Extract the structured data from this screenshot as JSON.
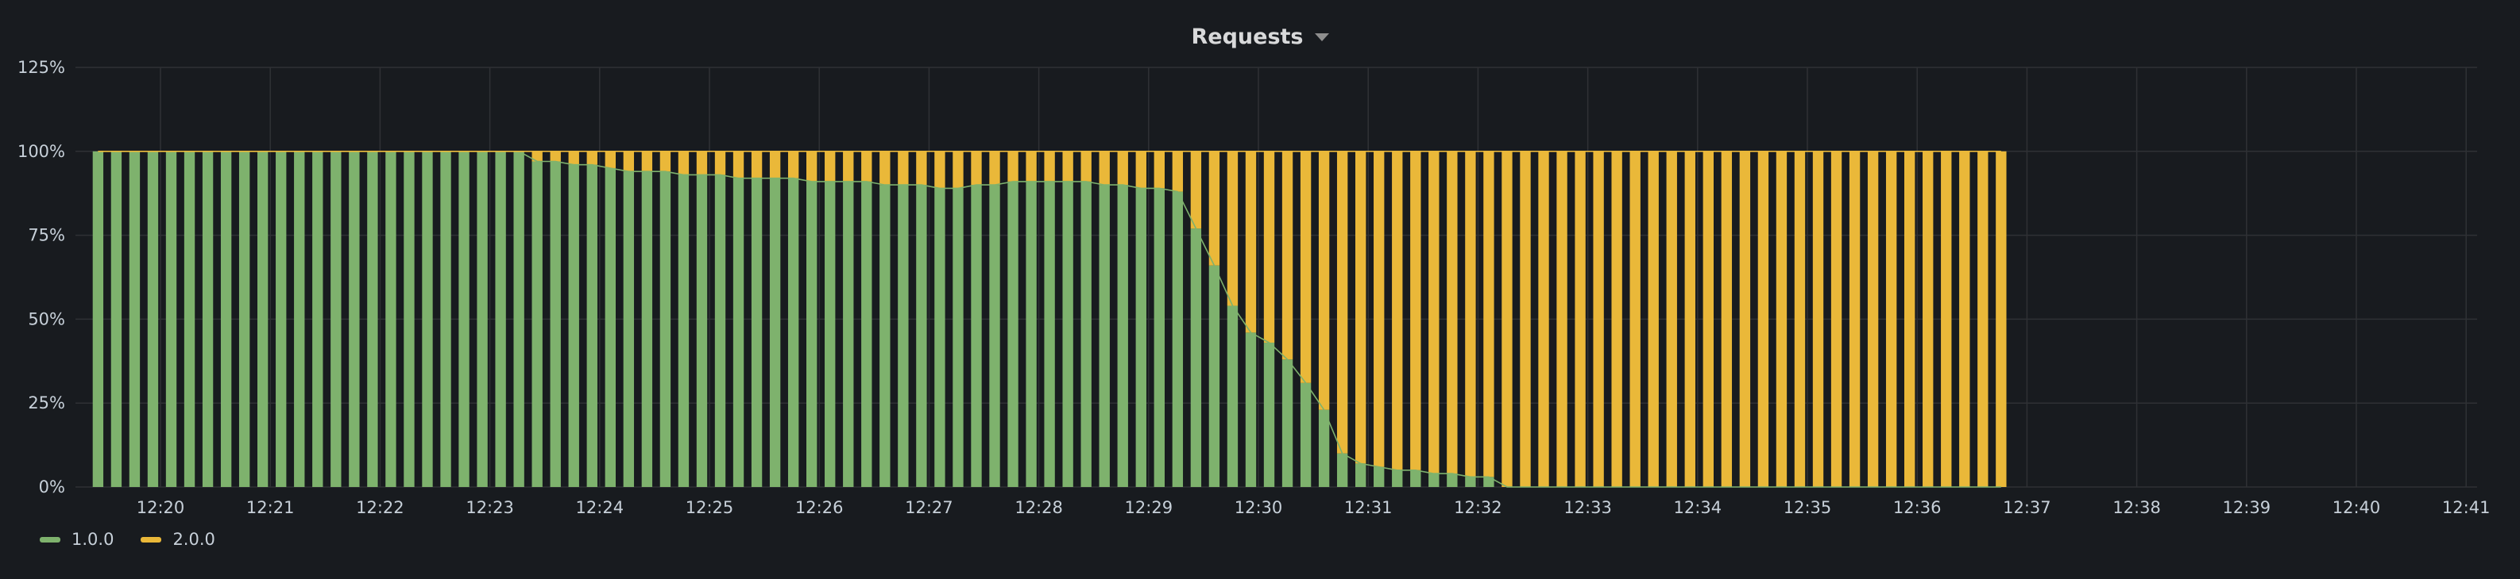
{
  "panel": {
    "title": "Requests"
  },
  "colors": {
    "background": "#181b1f",
    "grid": "#2f3135",
    "series_1": "#7eb26d",
    "series_2": "#eab839"
  },
  "chart_data": {
    "type": "bar",
    "stacked": true,
    "title": "Requests",
    "xlabel": "",
    "ylabel": "",
    "ylim": [
      0,
      125
    ],
    "y_ticks": [
      "0%",
      "25%",
      "50%",
      "75%",
      "100%",
      "125%"
    ],
    "x_ticks": [
      "12:20",
      "12:21",
      "12:22",
      "12:23",
      "12:24",
      "12:25",
      "12:26",
      "12:27",
      "12:28",
      "12:29",
      "12:30",
      "12:31",
      "12:32",
      "12:33",
      "12:34",
      "12:35",
      "12:36",
      "12:37",
      "12:38",
      "12:39",
      "12:40",
      "12:41"
    ],
    "grid": true,
    "legend_position": "bottom-left",
    "bars_per_minute": 6,
    "start_time": "12:19:25",
    "series": [
      {
        "name": "1.0.0",
        "values": [
          100,
          100,
          100,
          100,
          100,
          100,
          100,
          100,
          100,
          100,
          100,
          100,
          100,
          100,
          100,
          100,
          100,
          100,
          100,
          100,
          100,
          100,
          100,
          100,
          97,
          97,
          96,
          96,
          95,
          94,
          94,
          94,
          93,
          93,
          93,
          92,
          92,
          92,
          92,
          91,
          91,
          91,
          91,
          90,
          90,
          90,
          89,
          89,
          90,
          90,
          91,
          91,
          91,
          91,
          91,
          90,
          90,
          89,
          89,
          88,
          77,
          66,
          54,
          46,
          43,
          38,
          31,
          23,
          10,
          7,
          6,
          5,
          5,
          4,
          4,
          3,
          3,
          0,
          0,
          0,
          0,
          0,
          0,
          0,
          0,
          0,
          0,
          0,
          0,
          0,
          0,
          0,
          0,
          0,
          0,
          0,
          0,
          0,
          0,
          0,
          0,
          0,
          0,
          0,
          0
        ]
      },
      {
        "name": "2.0.0",
        "values": [
          0,
          0,
          0,
          0,
          0,
          0,
          0,
          0,
          0,
          0,
          0,
          0,
          0,
          0,
          0,
          0,
          0,
          0,
          0,
          0,
          0,
          0,
          0,
          0,
          3,
          3,
          4,
          4,
          5,
          6,
          6,
          6,
          7,
          7,
          7,
          8,
          8,
          8,
          8,
          9,
          9,
          9,
          9,
          10,
          10,
          10,
          11,
          11,
          10,
          10,
          9,
          9,
          9,
          9,
          9,
          10,
          10,
          11,
          11,
          12,
          23,
          34,
          46,
          54,
          57,
          62,
          69,
          77,
          90,
          93,
          94,
          95,
          95,
          96,
          96,
          97,
          97,
          100,
          100,
          100,
          100,
          100,
          100,
          100,
          100,
          100,
          100,
          100,
          100,
          100,
          100,
          100,
          100,
          100,
          100,
          100,
          100,
          100,
          100,
          100,
          100,
          100,
          100,
          100,
          100
        ]
      }
    ]
  },
  "legend": {
    "items": [
      {
        "label": "1.0.0",
        "color": "#7eb26d"
      },
      {
        "label": "2.0.0",
        "color": "#eab839"
      }
    ]
  }
}
